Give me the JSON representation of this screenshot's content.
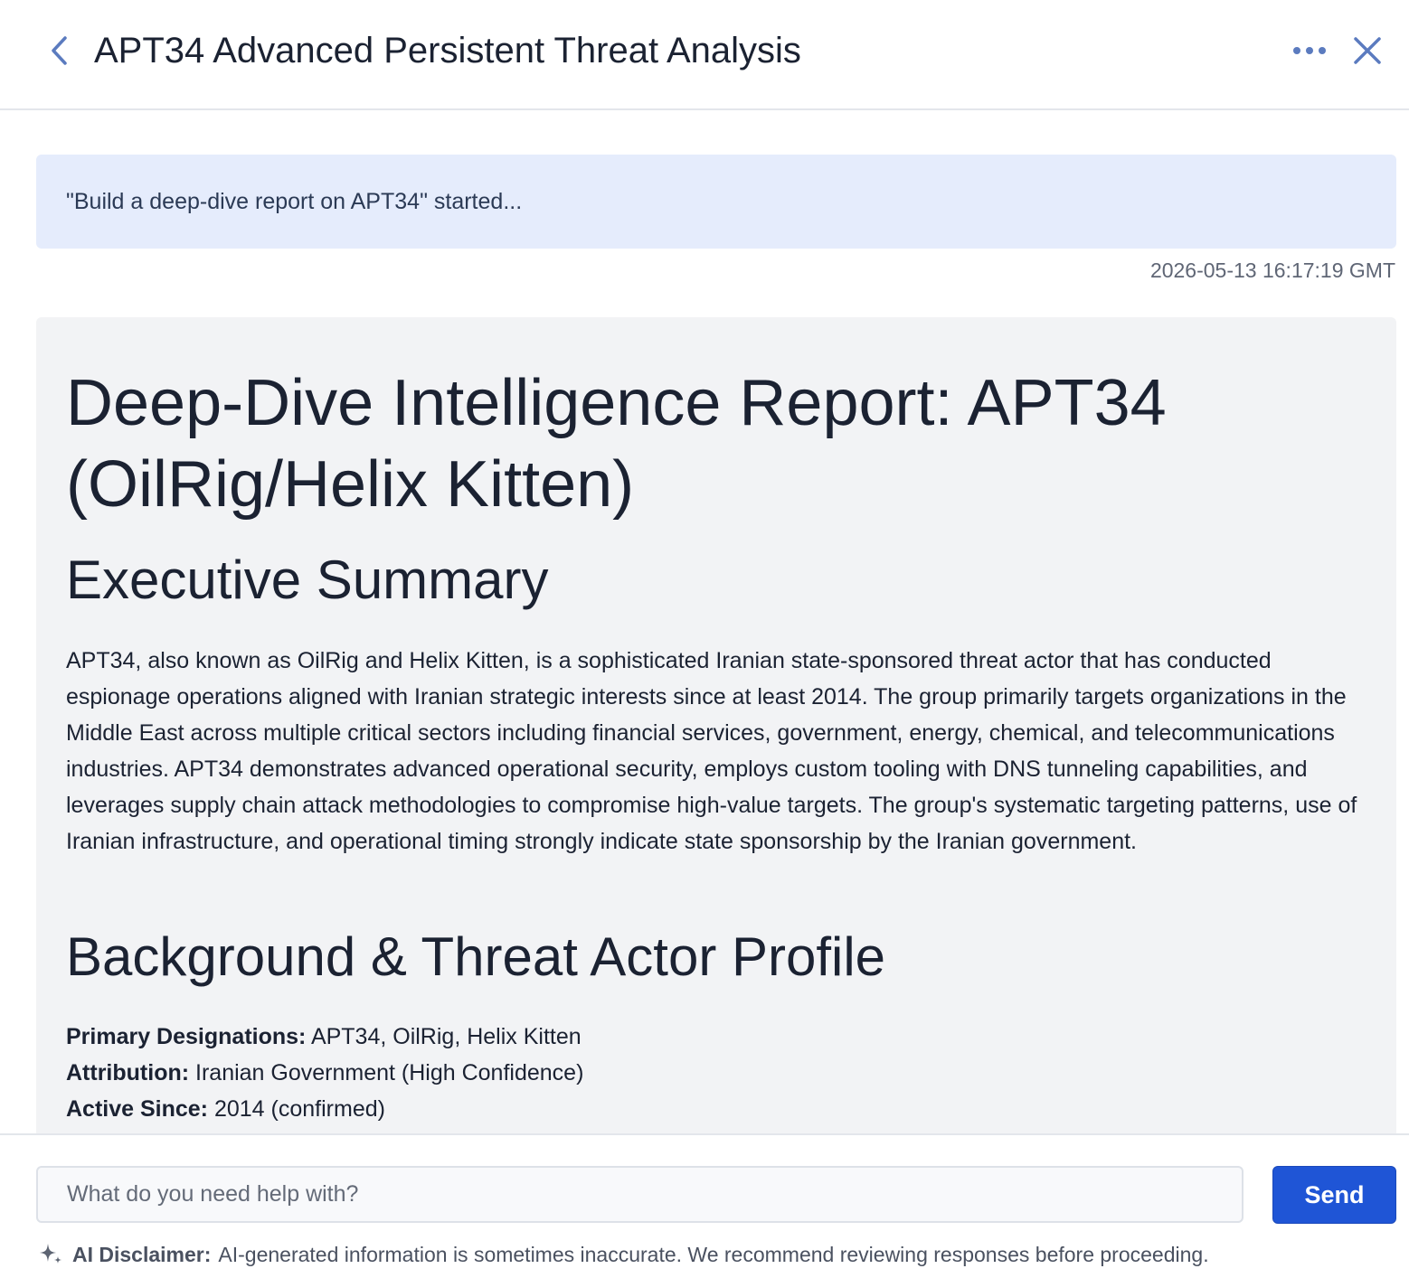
{
  "header": {
    "title": "APT34 Advanced Persistent Threat Analysis"
  },
  "prompt": {
    "text": "\"Build a deep-dive report on APT34\" started...",
    "timestamp": "2026-05-13 16:17:19 GMT"
  },
  "report": {
    "title": "Deep-Dive Intelligence Report: APT34 (OilRig/Helix Kitten)",
    "executive_summary_heading": "Executive Summary",
    "executive_summary": "APT34, also known as OilRig and Helix Kitten, is a sophisticated Iranian state-sponsored threat actor that has conducted espionage operations aligned with Iranian strategic interests since at least 2014. The group primarily targets organizations in the Middle East across multiple critical sectors including financial services, government, energy, chemical, and telecommunications industries. APT34 demonstrates advanced operational security, employs custom tooling with DNS tunneling capabilities, and leverages supply chain attack methodologies to compromise high-value targets. The group's systematic targeting patterns, use of Iranian infrastructure, and operational timing strongly indicate state sponsorship by the Iranian government.",
    "background_heading": "Background & Threat Actor Profile",
    "profile": [
      {
        "label": "Primary Designations:",
        "value": "APT34, OilRig, Helix Kitten"
      },
      {
        "label": "Attribution:",
        "value": "Iranian Government (High Confidence)"
      },
      {
        "label": "Active Since:",
        "value": "2014 (confirmed)"
      }
    ]
  },
  "footer": {
    "input_placeholder": "What do you need help with?",
    "send_label": "Send",
    "disclaimer_label": "AI Disclaimer:",
    "disclaimer_text": "AI-generated information is sometimes inaccurate. We recommend reviewing responses before proceeding."
  },
  "icons": {
    "back": "chevron-left-icon",
    "more": "more-horizontal-icon",
    "close": "close-icon",
    "disclaimer": "sparkle-icon"
  },
  "colors": {
    "accent": "#1f55d6",
    "banner": "#e5ecfc",
    "card": "#f2f3f5",
    "icon": "#5b7bbf"
  }
}
